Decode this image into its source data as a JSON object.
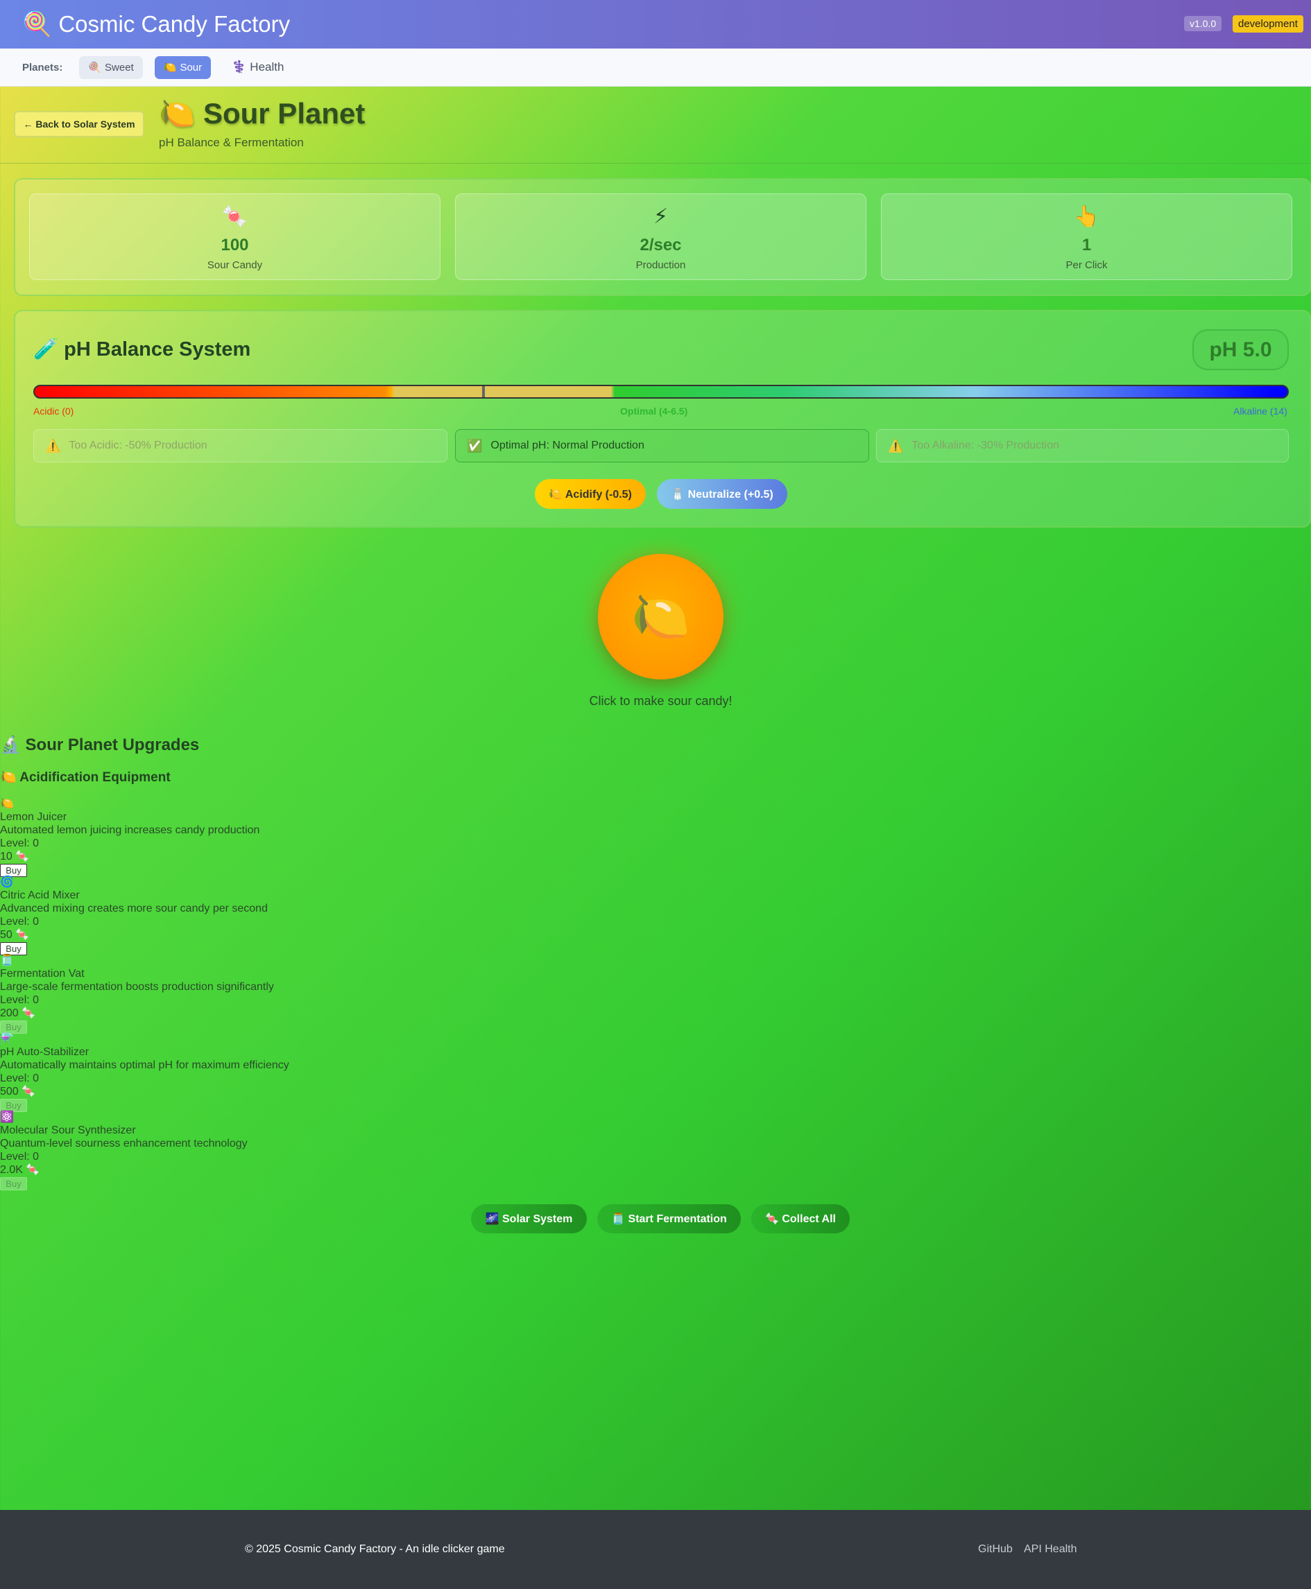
{
  "header": {
    "app_icon": "lollipop-icon",
    "title": "Cosmic Candy Factory",
    "version": "v1.0.0",
    "environment": "development"
  },
  "nav": {
    "label": "Planets:",
    "items": [
      {
        "icon": "🍭",
        "label": "Sweet"
      },
      {
        "icon": "🍋",
        "label": "Sour"
      },
      {
        "icon": "⚕️",
        "label": "Health"
      }
    ]
  },
  "planet": {
    "back_label": "← Back to Solar System",
    "icon": "🍋",
    "title": "Sour Planet",
    "subtitle": "pH Balance & Fermentation"
  },
  "stats": [
    {
      "icon": "🍬",
      "value": "100",
      "label": "Sour Candy"
    },
    {
      "icon": "⚡",
      "value": "2/sec",
      "label": "Production"
    },
    {
      "icon": "👆",
      "value": "1",
      "label": "Per Click"
    }
  ],
  "ph": {
    "icon": "🧪",
    "title": "pH Balance System",
    "badge": "pH 5.0",
    "value": 5.0,
    "scale_left": "Acidic (0)",
    "scale_mid": "Optimal (4-6.5)",
    "scale_right": "Alkaline (14)",
    "indicators": [
      {
        "icon": "⚠️",
        "text": "Too Acidic: -50% Production"
      },
      {
        "icon": "✅",
        "text": "Optimal pH: Normal Production"
      },
      {
        "icon": "⚠️",
        "text": "Too Alkaline: -30% Production"
      }
    ],
    "acidify_label": "🍋 Acidify (-0.5)",
    "neutralize_label": "🧂 Neutralize (+0.5)"
  },
  "clicker": {
    "icon": "🍋",
    "hint": "Click to make sour candy!"
  },
  "upgrades": {
    "title": "🔬 Sour Planet Upgrades",
    "section": "🍋 Acidification Equipment",
    "buy_label": "Buy",
    "items": [
      {
        "icon": "🍋",
        "name": "Lemon Juicer",
        "desc": "Automated lemon juicing increases candy production",
        "level": "Level: 0",
        "cost": "10 🍬"
      },
      {
        "icon": "🌀",
        "name": "Citric Acid Mixer",
        "desc": "Advanced mixing creates more sour candy per second",
        "level": "Level: 0",
        "cost": "50 🍬"
      },
      {
        "icon": "🫙",
        "name": "Fermentation Vat",
        "desc": "Large-scale fermentation boosts production significantly",
        "level": "Level: 0",
        "cost": "200 🍬"
      },
      {
        "icon": "⚗️",
        "name": "pH Auto-Stabilizer",
        "desc": "Automatically maintains optimal pH for maximum efficiency",
        "level": "Level: 0",
        "cost": "500 🍬"
      },
      {
        "icon": "⚛️",
        "name": "Molecular Sour Synthesizer",
        "desc": "Quantum-level sourness enhancement technology",
        "level": "Level: 0",
        "cost": "2.0K 🍬"
      }
    ]
  },
  "actions": {
    "solar": "🌌 Solar System",
    "ferment": "🫙 Start Fermentation",
    "collect": "🍬 Collect All"
  },
  "footer": {
    "copyright": "© 2025 Cosmic Candy Factory - An idle clicker game",
    "link1": "GitHub",
    "link2": "API Health"
  }
}
